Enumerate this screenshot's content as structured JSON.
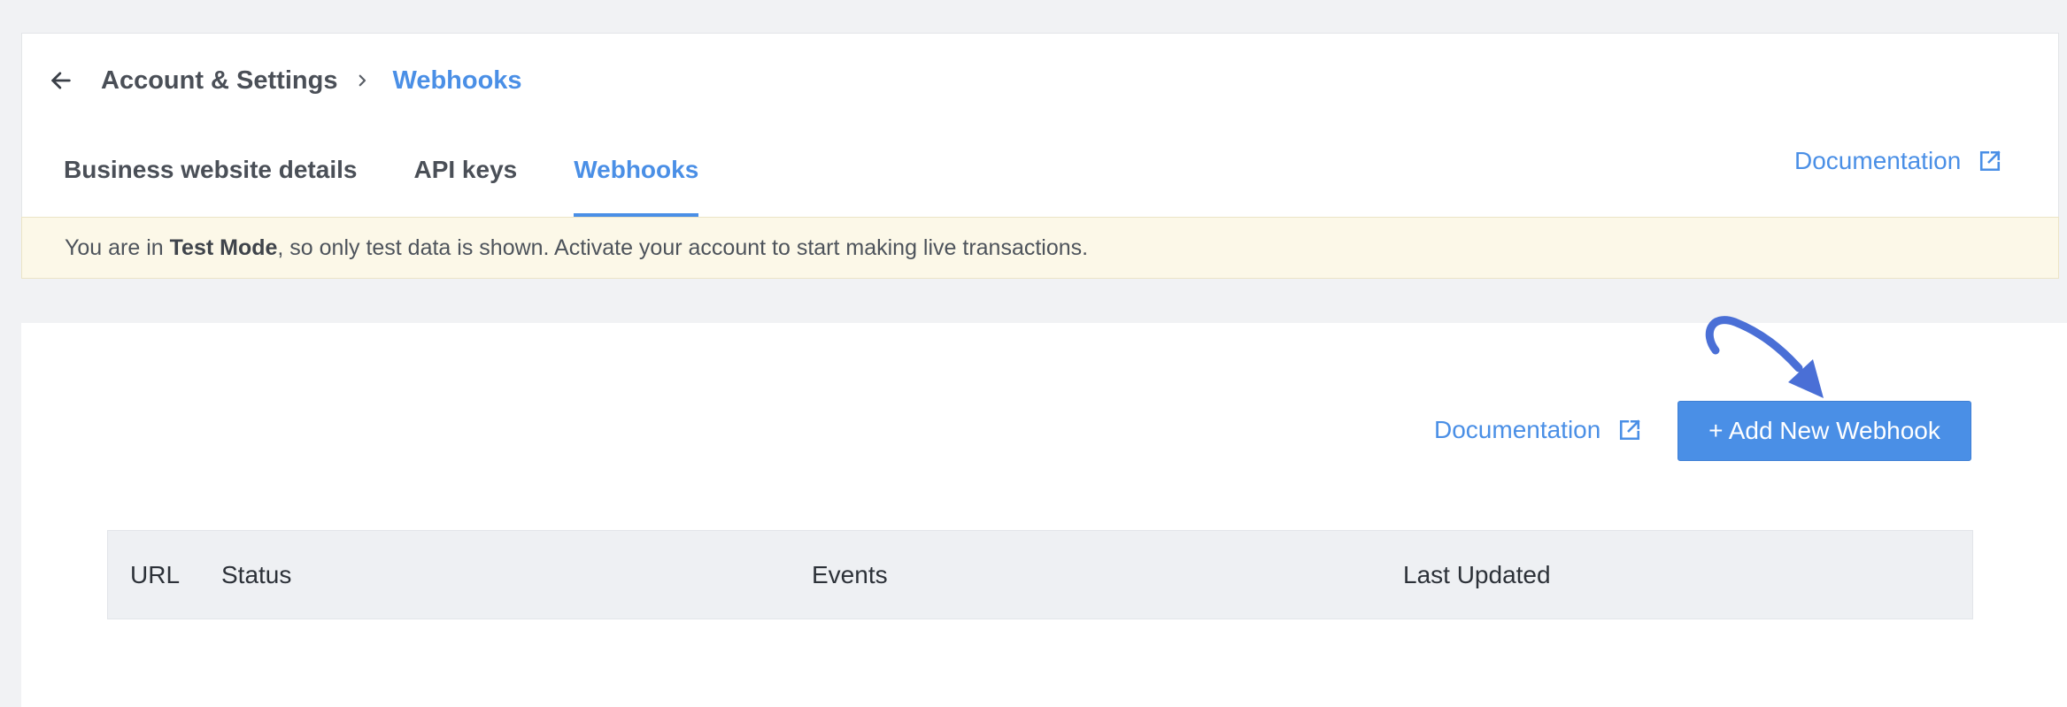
{
  "breadcrumb": {
    "back_icon": "arrow-left-icon",
    "parent": "Account & Settings",
    "separator_icon": "chevron-right-icon",
    "current": "Webhooks"
  },
  "tabs": [
    {
      "label": "Business website details",
      "active": false
    },
    {
      "label": "API keys",
      "active": false
    },
    {
      "label": "Webhooks",
      "active": true
    }
  ],
  "header_doc_link": {
    "label": "Documentation",
    "icon": "external-link-icon"
  },
  "banner": {
    "prefix": "You are in ",
    "mode": "Test Mode",
    "suffix": ", so only test data is shown. Activate your account to start making live transactions."
  },
  "main": {
    "doc_link": {
      "label": "Documentation",
      "icon": "external-link-icon"
    },
    "add_button_label": "+ Add New Webhook",
    "annotation_icon": "curved-arrow-icon"
  },
  "table": {
    "columns": [
      "URL",
      "Status",
      "Events",
      "Last Updated"
    ]
  },
  "colors": {
    "accent": "#4a8fe6",
    "banner_bg": "#fcf8e8",
    "page_bg": "#f1f2f4",
    "annotation": "#4a6fd6"
  }
}
